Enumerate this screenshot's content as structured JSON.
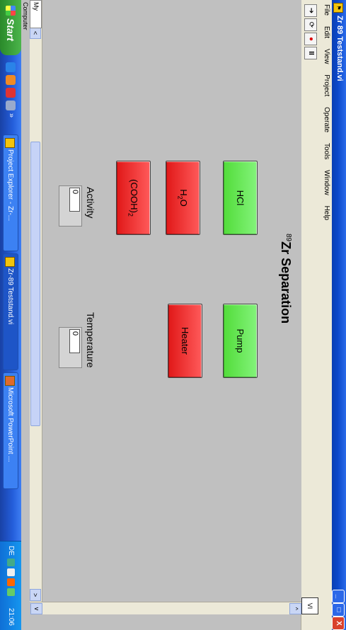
{
  "window": {
    "title": "Zr 89 Teststand.vi",
    "controls": {
      "minimize": "_",
      "maximize": "□",
      "close": "X"
    },
    "vi_icon_label": "VI"
  },
  "menu": [
    "File",
    "Edit",
    "View",
    "Project",
    "Operate",
    "Tools",
    "Window",
    "Help"
  ],
  "toolbar": {
    "run_glyph": "➔",
    "continuous_glyph": "⟳",
    "abort_glyph": "●",
    "pause_glyph": "II"
  },
  "panel": {
    "heading_sup": "89",
    "heading_text": "Zr Separation",
    "buttons": {
      "hcl": "HCl",
      "pump": "Pump",
      "h2o_main": "H",
      "h2o_sub": "2",
      "h2o_end": "O",
      "heater": "Heater",
      "cooh_main": "(COOH)",
      "cooh_sub": "2"
    },
    "activity": {
      "label": "Activity",
      "value": "0"
    },
    "temperature": {
      "label": "Temperature",
      "value": "0"
    }
  },
  "statusbar": {
    "context": "My Computer"
  },
  "scroll": {
    "left": "<",
    "right": ">",
    "up": "^",
    "down": "v"
  },
  "taskbar": {
    "start_label": "Start",
    "tasks": [
      {
        "label": "Project Explorer - Zr-..."
      },
      {
        "label": "Zr-89 Teststand.vi"
      },
      {
        "label": "Microsoft PowerPoint ..."
      }
    ],
    "more": "»",
    "language": "DE",
    "clock": "21:06"
  },
  "colors": {
    "on": "#52dc3a",
    "off": "#e01818",
    "panel_bg": "#c0c0c0"
  }
}
